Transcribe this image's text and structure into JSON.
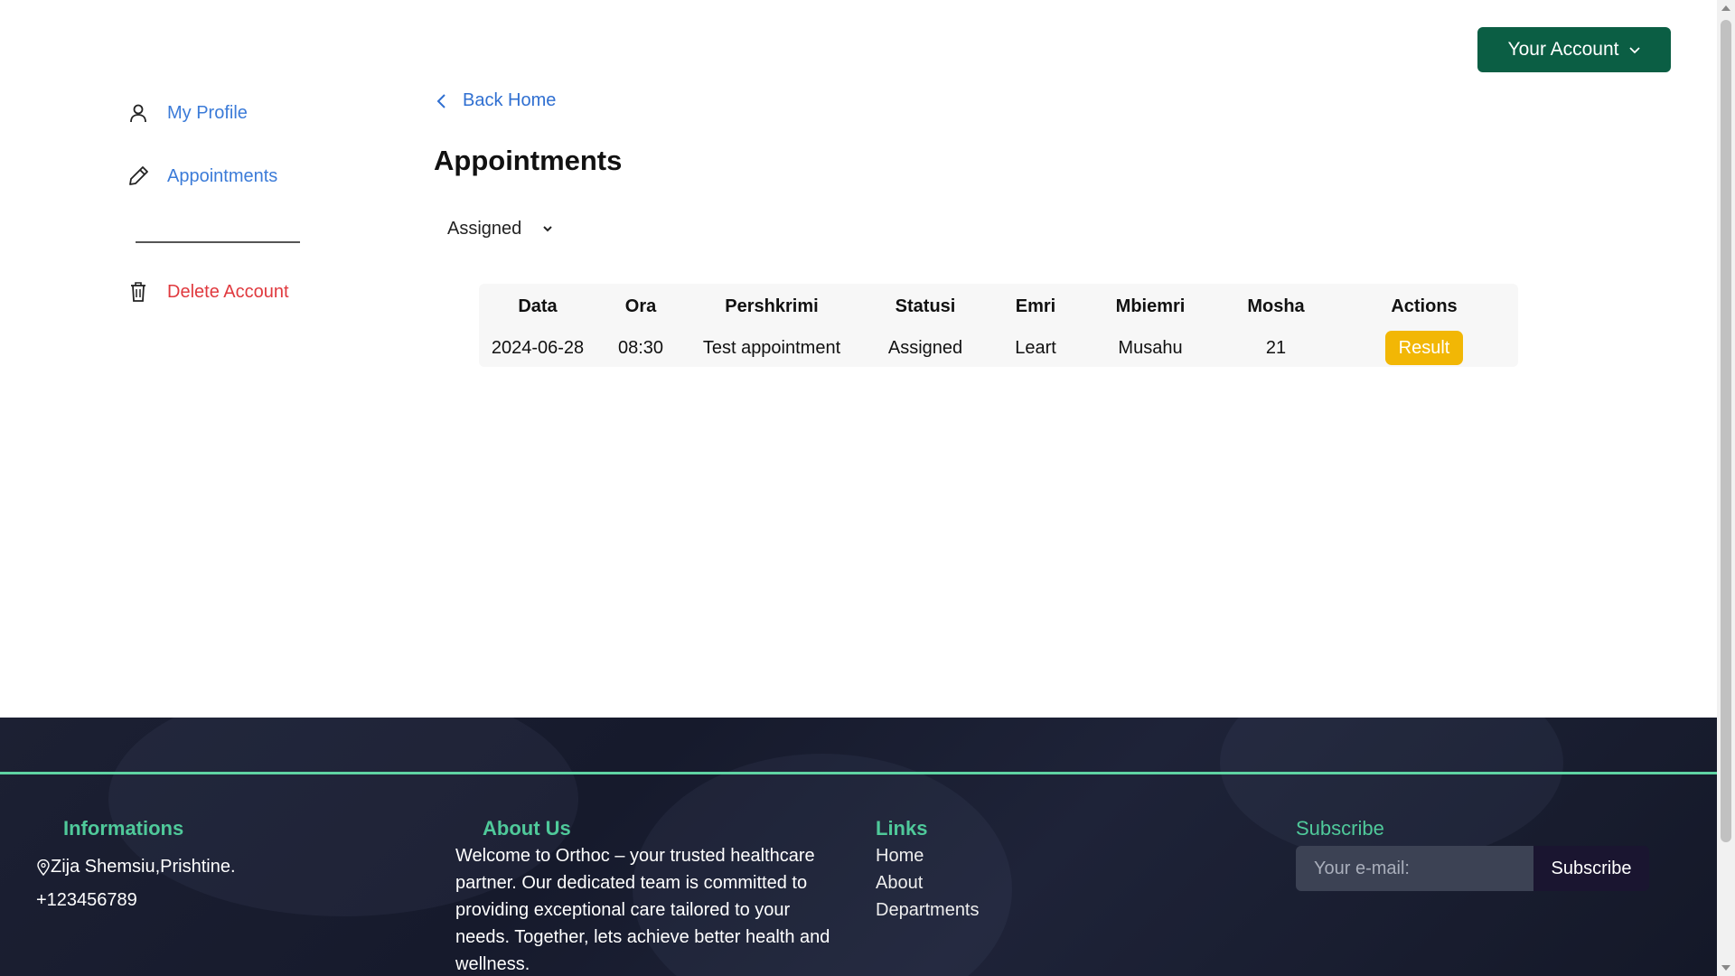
{
  "header": {
    "account_label": "Your Account"
  },
  "sidebar": {
    "items": [
      {
        "label": "My Profile",
        "icon": "user-icon"
      },
      {
        "label": "Appointments",
        "icon": "pencil-icon"
      }
    ],
    "delete_label": "Delete Account",
    "delete_icon": "trash-icon"
  },
  "main": {
    "back_label": "Back Home",
    "title": "Appointments",
    "filter_selected": "Assigned",
    "table": {
      "headers": [
        "Data",
        "Ora",
        "Pershkrimi",
        "Statusi",
        "Emri",
        "Mbiemri",
        "Mosha",
        "Actions"
      ],
      "rows": [
        {
          "data": "2024-06-28",
          "ora": "08:30",
          "pershkrimi": "Test appointment",
          "statusi": "Assigned",
          "emri": "Leart",
          "mbiemri": "Musahu",
          "mosha": "21",
          "action": "Result"
        }
      ]
    }
  },
  "footer": {
    "informations": {
      "heading": "Informations",
      "address": "Zija Shemsiu,Prishtine.",
      "phone": "+123456789"
    },
    "about": {
      "heading": "About Us",
      "text": "Welcome to Orthoc – your trusted healthcare partner. Our dedicated team is committed to providing exceptional care tailored to your needs. Together, lets achieve better health and wellness."
    },
    "links": {
      "heading": "Links",
      "items": [
        "Home",
        "About",
        "Departments"
      ]
    },
    "subscribe": {
      "heading": "Subscribe",
      "placeholder": "Your e-mail:",
      "button": "Subscribe"
    }
  },
  "colors": {
    "accent": "#0b5e44",
    "link": "#3b7bd8",
    "danger": "#e0393e",
    "result": "#f2b705",
    "footer_heading": "#4fc99a"
  }
}
